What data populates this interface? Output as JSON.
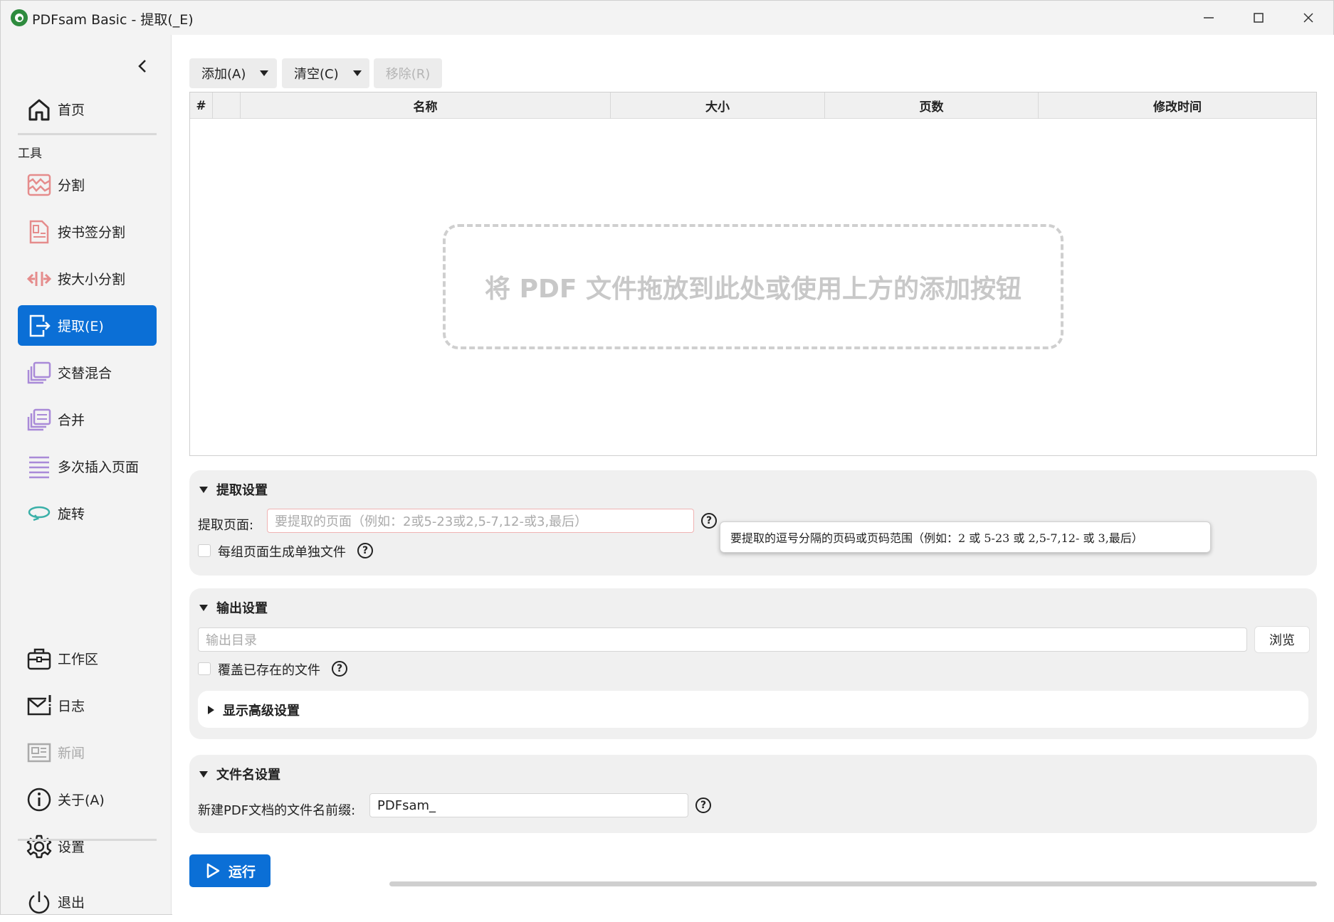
{
  "window": {
    "title": "PDFsam Basic - 提取(_E)",
    "controls": {
      "minimize": "minimize-icon",
      "maximize": "maximize-icon",
      "close": "close-icon"
    }
  },
  "sidebar": {
    "home_label": "首页",
    "tools_section_label": "工具",
    "tools": [
      {
        "label": "分割",
        "icon": "split-icon"
      },
      {
        "label": "按书签分割",
        "icon": "bookmark-split-icon"
      },
      {
        "label": "按大小分割",
        "icon": "size-split-icon"
      },
      {
        "label": "提取(E)",
        "icon": "extract-icon",
        "active": true
      },
      {
        "label": "交替混合",
        "icon": "alternate-mix-icon"
      },
      {
        "label": "合并",
        "icon": "merge-icon"
      },
      {
        "label": "多次插入页面",
        "icon": "insert-pages-icon"
      },
      {
        "label": "旋转",
        "icon": "rotate-icon"
      }
    ],
    "bottom": [
      {
        "label": "工作区",
        "icon": "workspace-icon"
      },
      {
        "label": "日志",
        "icon": "log-icon"
      },
      {
        "label": "新闻",
        "icon": "news-icon",
        "disabled": true
      },
      {
        "label": "关于(A)",
        "icon": "info-icon"
      },
      {
        "label": "设置",
        "icon": "gear-icon"
      }
    ],
    "exit_label": "退出"
  },
  "toolbar": {
    "add_label": "添加(A)",
    "clear_label": "清空(C)",
    "remove_label": "移除(R)"
  },
  "table": {
    "columns": [
      "#",
      "",
      "名称",
      "大小",
      "页数",
      "修改时间"
    ],
    "dropzone_text": "将 PDF 文件拖放到此处或使用上方的添加按钮"
  },
  "extract_settings": {
    "title": "提取设置",
    "pages_label": "提取页面:",
    "pages_placeholder": "要提取的页面（例如：2或5-23或2,5-7,12-或3,最后）",
    "pages_value": "",
    "separate_file_label": "每组页面生成单独文件",
    "separate_file_checked": false,
    "tooltip": "要提取的逗号分隔的页码或页码范围（例如：2 或 5-23 或 2,5-7,12- 或 3,最后）"
  },
  "output_settings": {
    "title": "输出设置",
    "dir_placeholder": "输出目录",
    "browse_label": "浏览",
    "overwrite_label": "覆盖已存在的文件",
    "overwrite_checked": false,
    "advanced_label": "显示高级设置"
  },
  "filename_settings": {
    "title": "文件名设置",
    "prefix_label": "新建PDF文档的文件名前缀:",
    "prefix_value": "PDFsam_"
  },
  "run_label": "运行",
  "colors": {
    "accent": "#0b6fd6",
    "panel_bg": "#f0f0f0",
    "sidebar_bg": "#f3f3f3"
  }
}
